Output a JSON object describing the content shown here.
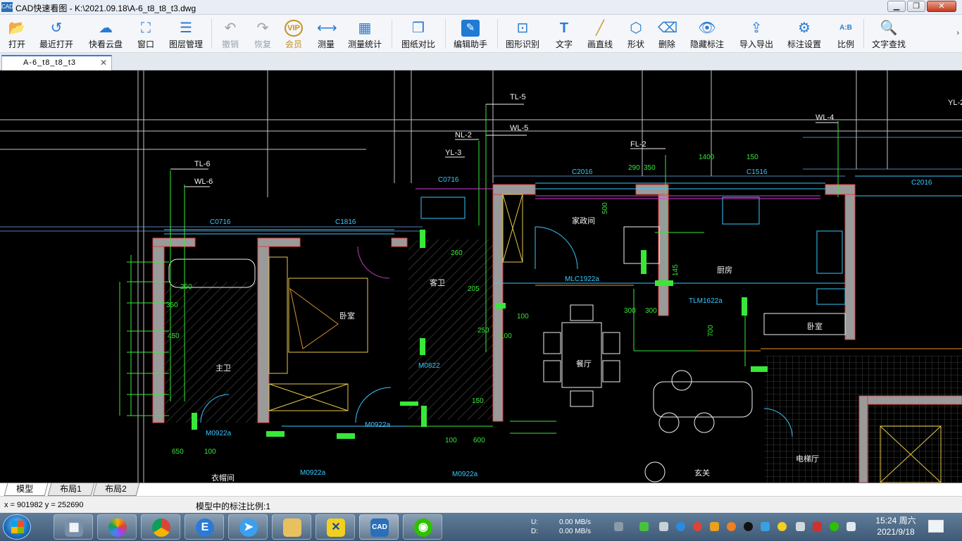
{
  "window": {
    "app_icon_text": "CAD",
    "title": "CAD快速看图 - K:\\2021.09.18\\A-6_t8_t8_t3.dwg",
    "minimize": "▁",
    "restore": "❐",
    "close": "✕"
  },
  "toolbar": {
    "items": [
      {
        "label": "打开",
        "icon": "folder-open-icon",
        "glyph": "📂"
      },
      {
        "label": "最近打开",
        "icon": "recent-icon",
        "glyph": "↺"
      },
      {
        "label": "快看云盘",
        "icon": "cloud-icon",
        "glyph": "☁"
      },
      {
        "label": "窗口",
        "icon": "window-icon",
        "glyph": "⛶"
      },
      {
        "label": "图层管理",
        "icon": "layers-icon",
        "glyph": "☰"
      },
      {
        "label": "撤销",
        "icon": "undo-icon",
        "glyph": "↶"
      },
      {
        "label": "恢复",
        "icon": "redo-icon",
        "glyph": "↷"
      },
      {
        "label": "会员",
        "icon": "vip-icon",
        "glyph": "VIP"
      },
      {
        "label": "测量",
        "icon": "measure-icon",
        "glyph": "⟷"
      },
      {
        "label": "测量统计",
        "icon": "measure-stats-icon",
        "glyph": "▦"
      },
      {
        "label": "图纸对比",
        "icon": "compare-icon",
        "glyph": "❒"
      },
      {
        "label": "编辑助手",
        "icon": "edit-assistant-icon",
        "glyph": "✎"
      },
      {
        "label": "图形识别",
        "icon": "shape-recognize-icon",
        "glyph": "⊡"
      },
      {
        "label": "文字",
        "icon": "text-icon",
        "glyph": "T"
      },
      {
        "label": "画直线",
        "icon": "line-icon",
        "glyph": "╱"
      },
      {
        "label": "形状",
        "icon": "shape-icon",
        "glyph": "⬡"
      },
      {
        "label": "删除",
        "icon": "eraser-icon",
        "glyph": "⌫"
      },
      {
        "label": "隐藏标注",
        "icon": "hide-annotation-icon",
        "glyph": "👁"
      },
      {
        "label": "导入导出",
        "icon": "import-export-icon",
        "glyph": "⇪"
      },
      {
        "label": "标注设置",
        "icon": "annotation-settings-icon",
        "glyph": "⚙"
      },
      {
        "label": "比例",
        "icon": "scale-icon",
        "glyph": "A:B"
      },
      {
        "label": "文字查找",
        "icon": "text-search-icon",
        "glyph": "🔍"
      }
    ],
    "more": "›"
  },
  "document_tab": {
    "label": "A-6_t8_t8_t3",
    "close": "✕"
  },
  "drawing": {
    "labels": [
      "TL-5",
      "WL-5",
      "NL-2",
      "YL-3",
      "TL-6",
      "WL-6",
      "WL-4",
      "FL-2",
      "YL-2"
    ],
    "room_labels": [
      "卧室",
      "卧室",
      "主卫",
      "客卫",
      "餐厅",
      "厨房",
      "电梯厅",
      "玄关",
      "衣帽间",
      "家政间"
    ],
    "door_window_tags": [
      "C0716",
      "C1816",
      "C0716",
      "C2016",
      "C1516",
      "C2016",
      "M0822",
      "M0922a",
      "M0922a",
      "M0922a",
      "M0922a",
      "MLC1922a",
      "TLM1622a"
    ],
    "dimensions": [
      "1400",
      "150",
      "290",
      "350",
      "500",
      "260",
      "260",
      "350",
      "450",
      "250",
      "205",
      "150",
      "650",
      "100",
      "600",
      "100",
      "300",
      "100",
      "300",
      "700",
      "100",
      "145"
    ]
  },
  "layout_tabs": [
    "模型",
    "布局1",
    "布局2"
  ],
  "status": {
    "coords": "x = 901982  y = 252690",
    "scale_text": "模型中的标注比例:1"
  },
  "taskbar": {
    "apps": [
      "calculator",
      "picture-viewer",
      "chrome",
      "e-browser",
      "feiyu",
      "file-explorer",
      "x-tool",
      "cad-viewer",
      "wechat"
    ],
    "net_upload_label": "U:",
    "net_download_label": "D:",
    "net_upload": "0.00 MB/s",
    "net_download": "0.00 MB/s",
    "time": "15:24 周六",
    "date": "2021/9/18"
  }
}
